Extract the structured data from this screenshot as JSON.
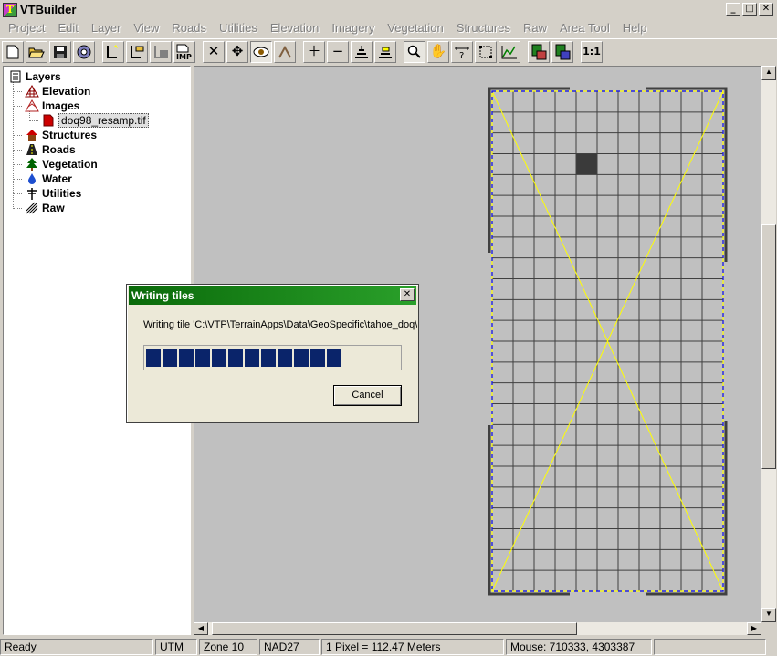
{
  "window": {
    "title": "VTBuilder",
    "controls": [
      "_",
      "□",
      "✕"
    ]
  },
  "menu": [
    "Project",
    "Edit",
    "Layer",
    "View",
    "Roads",
    "Utilities",
    "Elevation",
    "Imagery",
    "Vegetation",
    "Structures",
    "Raw",
    "Area Tool",
    "Help"
  ],
  "toolbar": {
    "zoom_1to1": "1:1",
    "buttons": [
      "new-icon",
      "open-icon",
      "save-icon",
      "options-icon",
      "new-layer-icon",
      "open-layer-icon",
      "save-layer-icon",
      "import-icon",
      "delete-icon",
      "move-icon",
      "eye-icon",
      "profile-icon",
      "zoom-in-icon",
      "zoom-out-icon",
      "zoom-all-icon",
      "zoom-layer-icon",
      "magnifier-icon",
      "pan-icon",
      "distance-icon",
      "area-tool-icon",
      "elevation-profile-icon",
      "grid-icon",
      "grid2-icon"
    ]
  },
  "tree": {
    "root": "Layers",
    "items": [
      {
        "label": "Elevation",
        "icon": "elevation-icon",
        "color": "#8b0000"
      },
      {
        "label": "Images",
        "icon": "images-icon",
        "color": "#b22222"
      },
      {
        "label": "doq98_resamp.tif",
        "icon": "image-file-icon",
        "color": "#cc0000"
      },
      {
        "label": "Structures",
        "icon": "house-icon",
        "color": "#8b4513"
      },
      {
        "label": "Roads",
        "icon": "roads-icon",
        "color": "#000"
      },
      {
        "label": "Vegetation",
        "icon": "tree-icon",
        "color": "#006400"
      },
      {
        "label": "Water",
        "icon": "water-drop-icon",
        "color": "#1e4fd0"
      },
      {
        "label": "Utilities",
        "icon": "utility-pole-icon",
        "color": "#000"
      },
      {
        "label": "Raw",
        "icon": "raw-icon",
        "color": "#000"
      }
    ]
  },
  "dialog": {
    "title": "Writing tiles",
    "message": "Writing tile 'C:\\VTP\\TerrainApps\\Data\\GeoSpecific\\tahoe_doq\\l",
    "progress_fraction": 0.88,
    "cancel_label": "Cancel"
  },
  "map": {
    "grid_cols": 11,
    "grid_rows": 24,
    "highlight_cell": {
      "col": 4,
      "row": 3
    },
    "boundary_color": "#ffff00",
    "dash_color": "#0000ff"
  },
  "status": {
    "ready": "Ready",
    "projection": "UTM",
    "zone": "Zone 10",
    "datum": "NAD27",
    "scale": "1 Pixel = 112.47 Meters",
    "mouse": "Mouse: 710333, 4303387"
  }
}
